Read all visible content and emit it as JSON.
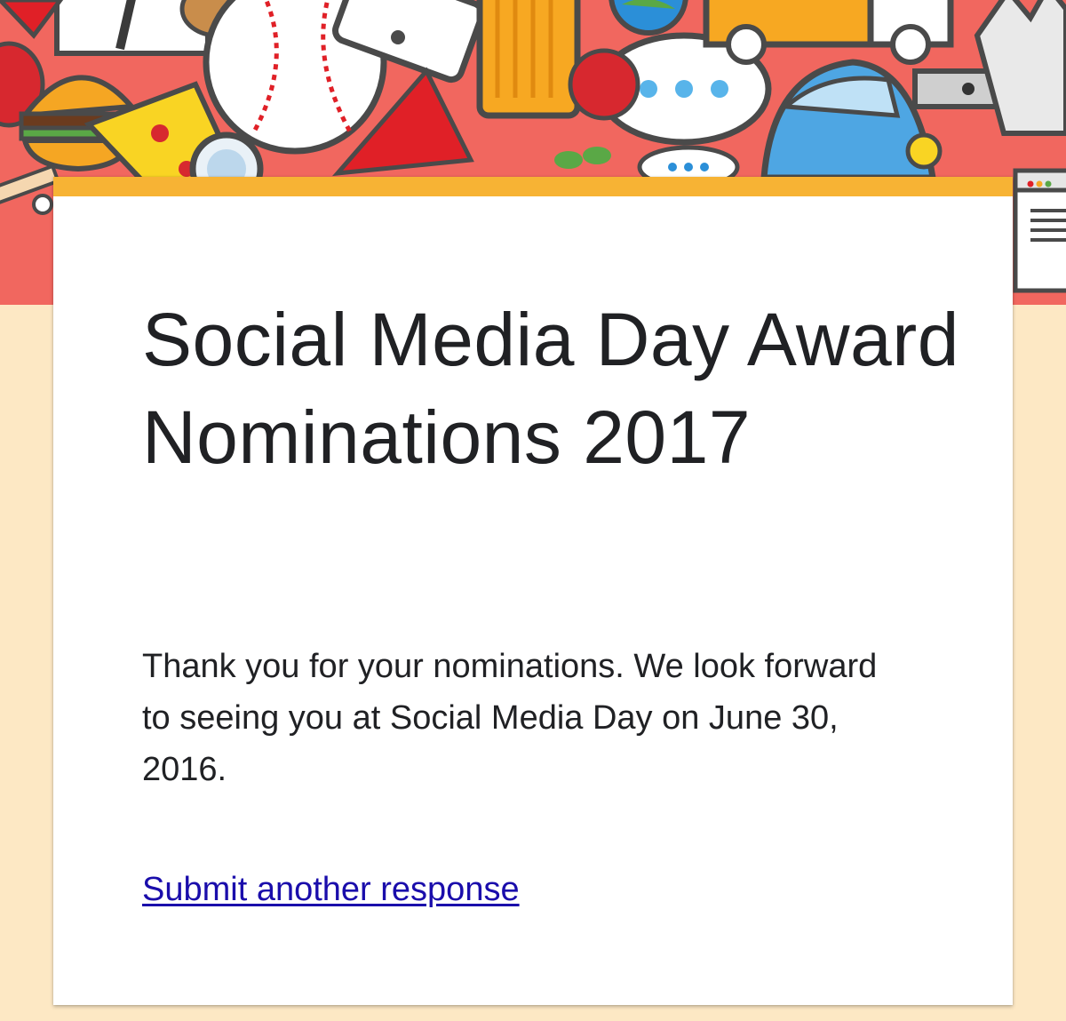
{
  "header": {
    "banner_name": "doodle-header-image",
    "colors": {
      "banner_background": "#f1675f",
      "page_background": "#fde8c4",
      "card_accent": "#f7b334"
    }
  },
  "form": {
    "title": "Social Media Day Award Nominations 2017",
    "confirmation_message": "Thank you for your nominations. We look forward to seeing you at Social Media Day on June 30, 2016.",
    "submit_another_label": "Submit another response",
    "link_color": "#1a0dab"
  }
}
